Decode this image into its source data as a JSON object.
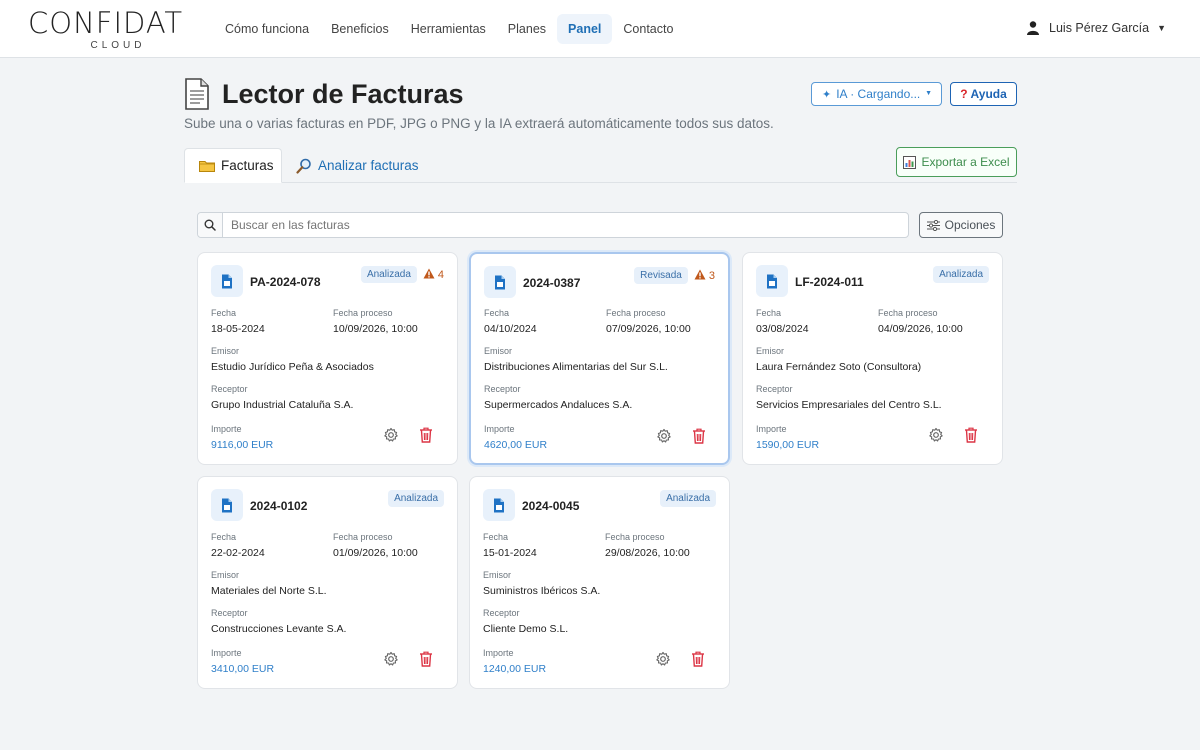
{
  "nav": {
    "logo": "CONFIDAT",
    "logo_sub": "CLOUD",
    "links": [
      "Cómo funciona",
      "Beneficios",
      "Herramientas",
      "Planes",
      "Panel",
      "Contacto"
    ],
    "user": "Luis Pérez García"
  },
  "header": {
    "title": "Lector de Facturas",
    "subtitle": "Sube una o varias facturas en PDF, JPG o PNG y la IA extraerá automáticamente todos sus datos.",
    "ia_button": "IA · Cargando...",
    "help_button": "Ayuda"
  },
  "tabs": {
    "facturas": "Facturas",
    "analizar": "Analizar facturas"
  },
  "export_button": "Exportar a Excel",
  "search": {
    "placeholder": "Buscar en las facturas",
    "options_button": "Opciones"
  },
  "labels": {
    "fecha": "Fecha",
    "fecha_proceso": "Fecha proceso",
    "emisor": "Emisor",
    "receptor": "Receptor",
    "importe": "Importe"
  },
  "invoices": [
    {
      "id": "PA-2024-078",
      "status": "Analizada",
      "warnings": "4",
      "fecha": "18-05-2024",
      "fecha_proceso": "10/09/2026, 10:00",
      "emisor": "Estudio Jurídico Peña & Asociados",
      "receptor": "Grupo Industrial Cataluña S.A.",
      "importe": "9116,00 EUR"
    },
    {
      "id": "2024-0387",
      "status": "Revisada",
      "warnings": "3",
      "fecha": "04/10/2024",
      "fecha_proceso": "07/09/2026, 10:00",
      "emisor": "Distribuciones Alimentarias del Sur S.L.",
      "receptor": "Supermercados Andaluces S.A.",
      "importe": "4620,00 EUR"
    },
    {
      "id": "LF-2024-011",
      "status": "Analizada",
      "warnings": "",
      "fecha": "03/08/2024",
      "fecha_proceso": "04/09/2026, 10:00",
      "emisor": "Laura Fernández Soto (Consultora)",
      "receptor": "Servicios Empresariales del Centro S.L.",
      "importe": "1590,00 EUR"
    },
    {
      "id": "2024-0102",
      "status": "Analizada",
      "warnings": "",
      "fecha": "22-02-2024",
      "fecha_proceso": "01/09/2026, 10:00",
      "emisor": "Materiales del Norte S.L.",
      "receptor": "Construcciones Levante S.A.",
      "importe": "3410,00 EUR"
    },
    {
      "id": "2024-0045",
      "status": "Analizada",
      "warnings": "",
      "fecha": "15-01-2024",
      "fecha_proceso": "29/08/2026, 10:00",
      "emisor": "Suministros Ibéricos S.A.",
      "receptor": "Cliente Demo S.L.",
      "importe": "1240,00 EUR"
    }
  ]
}
